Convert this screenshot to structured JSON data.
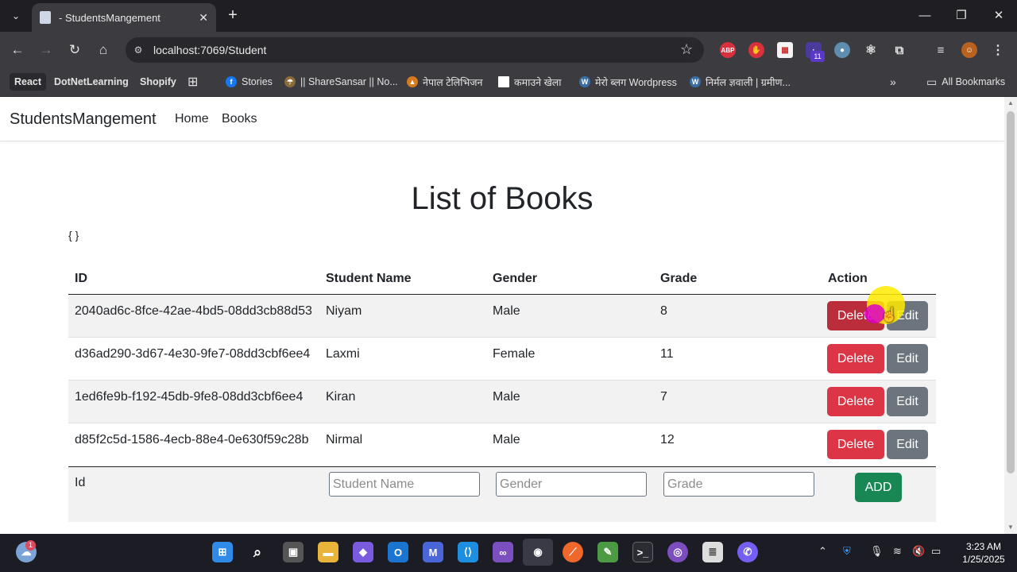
{
  "browser": {
    "tab_title": "- StudentsMangement",
    "url": "localhost:7069/Student",
    "bookmarks": [
      {
        "label": "React"
      },
      {
        "label": "DotNetLearning"
      },
      {
        "label": "Shopify"
      },
      {
        "label": "Stories"
      },
      {
        "label": "|| ShareSansar || No..."
      },
      {
        "label": "नेपाल टेलिभिजन"
      },
      {
        "label": "कमाउने खेला"
      },
      {
        "label": "मेरो ब्लग Wordpress"
      },
      {
        "label": "निर्मल ज्ञवाली | ग्रमीण..."
      }
    ],
    "all_bookmarks": "All Bookmarks",
    "extension_badge": "11",
    "abp_label": "ABP"
  },
  "app": {
    "brand": "StudentsMangement",
    "nav": [
      {
        "label": "Home"
      },
      {
        "label": "Books"
      }
    ],
    "page_title": "List of Books",
    "json_dump": "{ }"
  },
  "table": {
    "headers": [
      "ID",
      "Student Name",
      "Gender",
      "Grade",
      "Action"
    ],
    "rows": [
      {
        "id": "2040ad6c-8fce-42ae-4bd5-08dd3cb88d53",
        "name": "Niyam",
        "gender": "Male",
        "grade": "8"
      },
      {
        "id": "d36ad290-3d67-4e30-9fe7-08dd3cbf6ee4",
        "name": "Laxmi",
        "gender": "Female",
        "grade": "11"
      },
      {
        "id": "1ed6fe9b-f192-45db-9fe8-08dd3cbf6ee4",
        "name": "Kiran",
        "gender": "Male",
        "grade": "7"
      },
      {
        "id": "d85f2c5d-1586-4ecb-88e4-0e630f59c28b",
        "name": "Nirmal",
        "gender": "Male",
        "grade": "12"
      }
    ],
    "delete_label": "Delete",
    "edit_label": "Edit"
  },
  "form": {
    "id_label": "Id",
    "name_placeholder": "Student Name",
    "gender_placeholder": "Gender",
    "grade_placeholder": "Grade",
    "add_label": "ADD"
  },
  "taskbar": {
    "notification_badge": "1",
    "time": "3:23 AM",
    "date": "1/25/2025"
  },
  "colors": {
    "danger": "#dc3545",
    "secondary": "#6c757d",
    "success": "#198754"
  }
}
